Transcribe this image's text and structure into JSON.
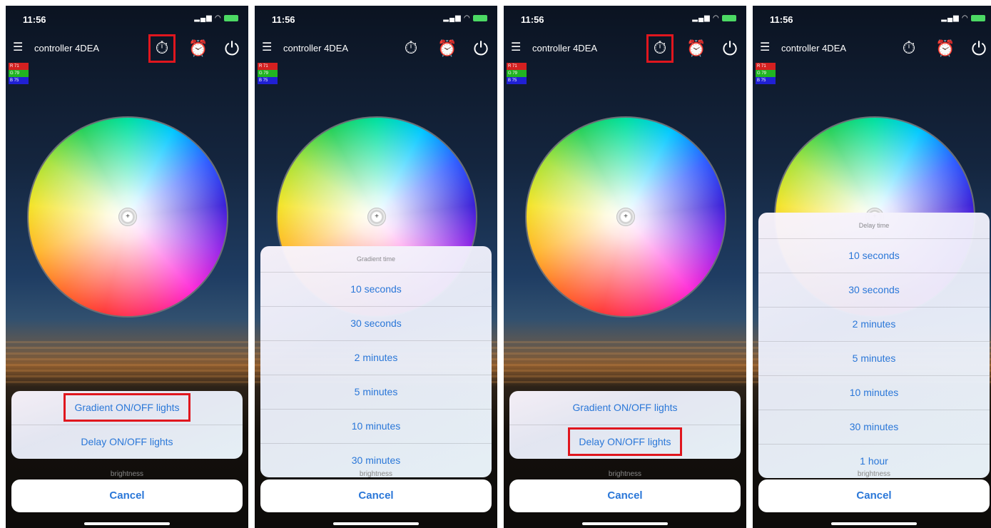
{
  "status": {
    "time": "11:56"
  },
  "nav": {
    "title": "controller 4DEA"
  },
  "rgb": {
    "r": "71",
    "g": "79",
    "b": "75"
  },
  "action_sheet": {
    "gradient": "Gradient ON/OFF lights",
    "delay": "Delay ON/OFF lights"
  },
  "gradient_picker": {
    "header": "Gradient time",
    "options": [
      "10 seconds",
      "30 seconds",
      "2 minutes",
      "5 minutes",
      "10 minutes",
      "30 minutes"
    ]
  },
  "delay_picker": {
    "header": "Delay time",
    "options": [
      "10 seconds",
      "30 seconds",
      "2 minutes",
      "5 minutes",
      "10 minutes",
      "30 minutes",
      "1 hour"
    ]
  },
  "brightness_label": "brightness",
  "cancel_label": "Cancel",
  "colors": {
    "highlight": "#e0161e",
    "accent": "#2a77d8",
    "r_chip": "#d42020",
    "g_chip": "#21b421",
    "b_chip": "#2020d4"
  }
}
